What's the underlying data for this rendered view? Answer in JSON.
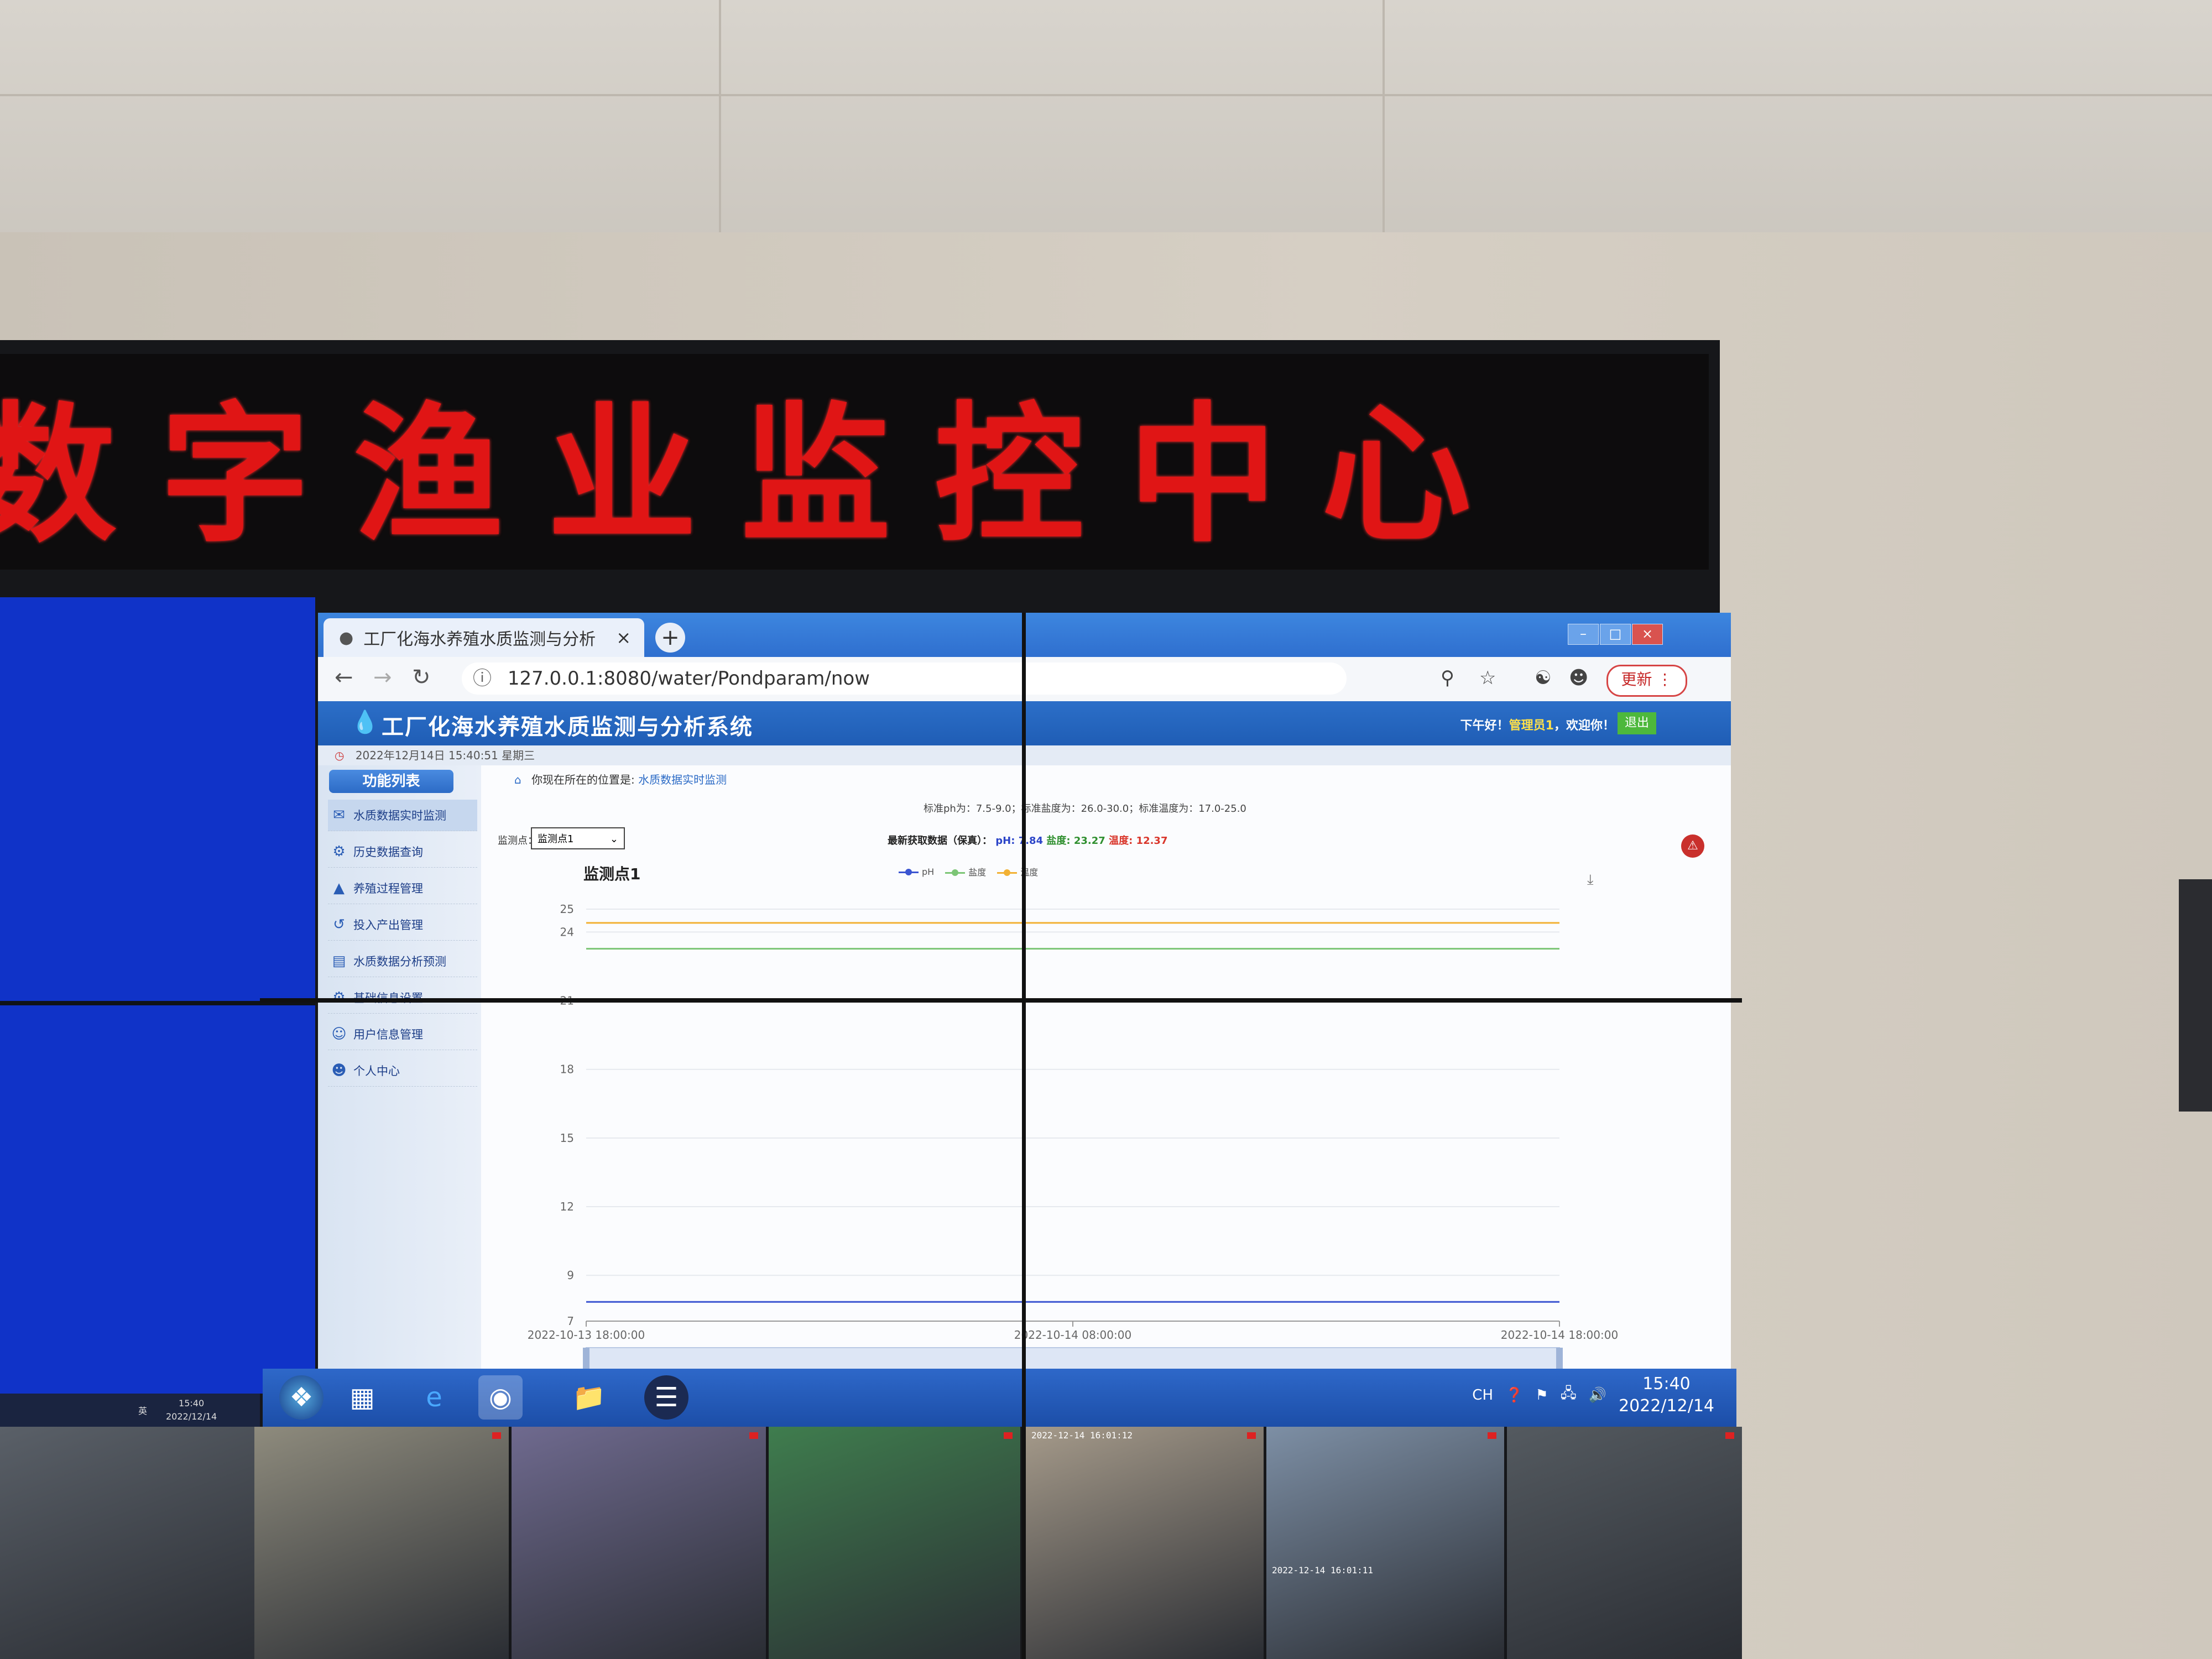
{
  "led_sign": {
    "text": "数字渔业监控中心"
  },
  "browser": {
    "tab_title": "工厂化海水养殖水质监测与分析",
    "url": "127.0.0.1:8080/water/Pondparam/now",
    "update_label": "更新"
  },
  "app": {
    "title": "工厂化海水养殖水质监测与分析系统",
    "greeting_prefix": "下午好！",
    "user": "管理员1",
    "greeting_suffix": "，欢迎你！",
    "logout_label": "退出",
    "datetime": "2022年12月14日 15:40:51 星期三"
  },
  "sidebar": {
    "header": "功能列表",
    "items": [
      {
        "label": "水质数据实时监测",
        "icon": "water-data-icon"
      },
      {
        "label": "历史数据查询",
        "icon": "history-icon"
      },
      {
        "label": "养殖过程管理",
        "icon": "process-icon"
      },
      {
        "label": "投入产出管理",
        "icon": "io-icon"
      },
      {
        "label": "水质数据分析预测",
        "icon": "analysis-icon"
      },
      {
        "label": "基础信息设置",
        "icon": "settings-icon"
      },
      {
        "label": "用户信息管理",
        "icon": "users-icon"
      },
      {
        "label": "个人中心",
        "icon": "person-icon"
      }
    ]
  },
  "main": {
    "crumb_prefix": "你现在所在的位置是:",
    "crumb_link": "水质数据实时监测",
    "standards": "标准ph为：7.5-9.0；标准盐度为：26.0-30.0；标准温度为：17.0-25.0",
    "latest_prefix": "最新获取数据（保真）：",
    "latest_ph": "pH: 7.84",
    "latest_salinity": "盐度: 23.27",
    "latest_temp": "温度: 12.37",
    "monitor_label": "监测点：",
    "monitor_selected": "监测点1"
  },
  "chart_data": {
    "type": "line",
    "title": "监测点1",
    "series": [
      {
        "name": "pH",
        "color": "#3b55d1",
        "points": [
          [
            0,
            7.84
          ],
          [
            1,
            7.84
          ],
          [
            2,
            7.84
          ]
        ]
      },
      {
        "name": "盐度",
        "color": "#7cc576",
        "points": [
          [
            0,
            23.27
          ],
          [
            1,
            23.27
          ],
          [
            2,
            23.27
          ]
        ]
      },
      {
        "name": "温度",
        "color": "#f2b134",
        "points": [
          [
            0,
            24.4
          ],
          [
            1,
            24.4
          ],
          [
            2,
            24.4
          ]
        ]
      }
    ],
    "x_ticks": [
      "2022-10-13 18:00:00",
      "2022-10-14 08:00:00",
      "2022-10-14 18:00:00"
    ],
    "y_ticks": [
      7,
      9,
      12,
      15,
      18,
      21,
      24,
      25
    ],
    "ylim": [
      7,
      25
    ],
    "legend_position": "top-center",
    "grid": true
  },
  "taskbar": {
    "lang": "CH",
    "time": "15:40",
    "date": "2022/12/14",
    "left_screen_time": "15:40",
    "left_screen_date": "2022/12/14",
    "left_screen_lang": "英"
  },
  "cameras": [
    {
      "timestamp": "2022-12-14 16:01:12",
      "color": "#8e8b7d"
    },
    {
      "timestamp": "",
      "color": "#6f6a8f"
    },
    {
      "timestamp": "",
      "color": "#3f7d4e"
    },
    {
      "timestamp": "2022-12-14 16:01:11",
      "color": "#a59a8a"
    },
    {
      "timestamp": "",
      "color": "#7d8fa5"
    },
    {
      "timestamp": "",
      "color": "#545a60"
    }
  ]
}
